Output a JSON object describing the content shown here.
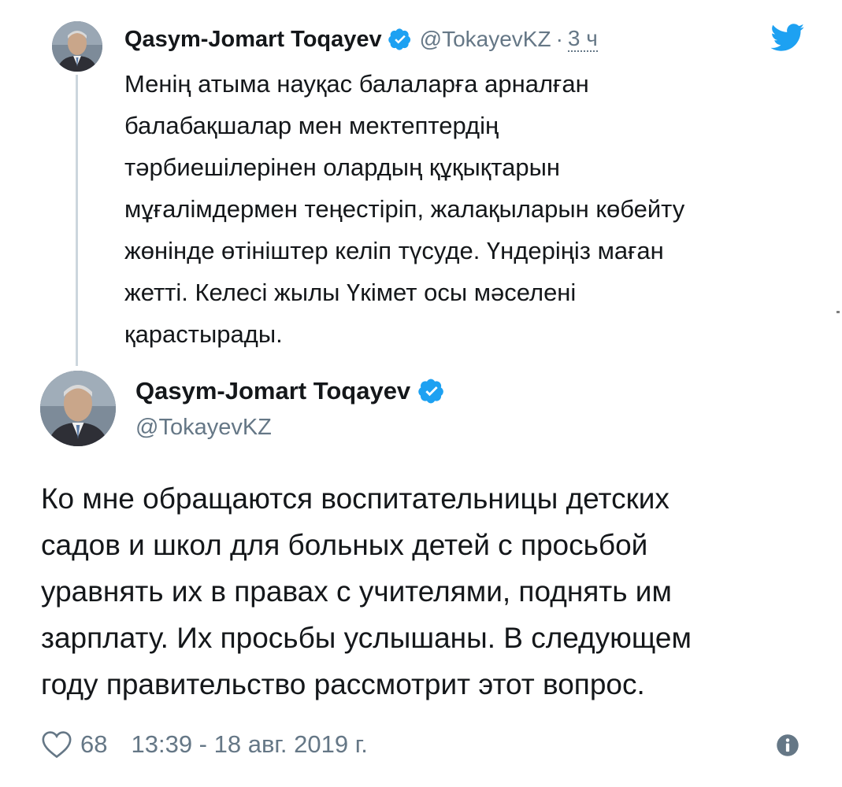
{
  "reply_tweet": {
    "author_name": "Qasym-Jomart Toqayev",
    "handle": "@TokayevKZ",
    "separator": "·",
    "time_ago": "3 ч",
    "text": "Менің атыма науқас балаларға арналған\nбалабақшалар мен мектептердің\nтәрбиешілерінен олардың құқықтарын\nмұғалімдермен теңестіріп, жалақыларын көбейту\nжөнінде өтініштер келіп түсуде. Үндеріңіз маған\nжетті. Келесі жылы Үкімет осы мәселені\nқарастырады."
  },
  "main_tweet": {
    "author_name": "Qasym-Jomart Toqayev",
    "handle": "@TokayevKZ",
    "text": "Ко мне обращаются воспитательницы детских\nсадов и школ для больных детей с просьбой\nуравнять их в правах с учителями, поднять им\nзарплату. Их просьбы услышаны. В следующем\nгоду правительство рассмотрит этот вопрос.",
    "likes": "68",
    "timestamp": "13:39 - 18 авг. 2019 г."
  },
  "icons": {
    "brand": "twitter-bird-icon",
    "verified": "verified-badge-icon",
    "like": "heart-icon",
    "info": "info-icon"
  },
  "colors": {
    "twitter_blue": "#1da1f2",
    "text_primary": "#14171a",
    "text_secondary": "#657786",
    "thread_line": "#ccd6dd"
  }
}
